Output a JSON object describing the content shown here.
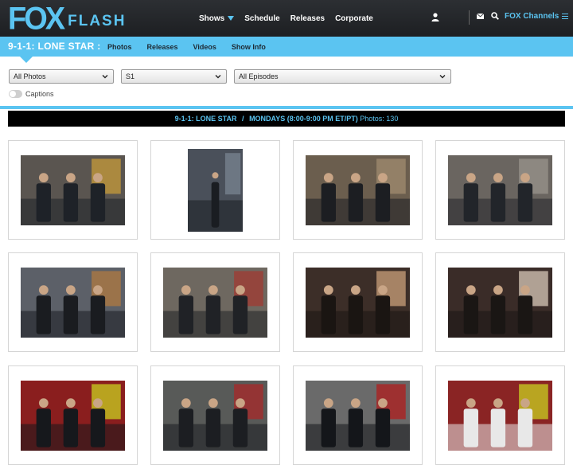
{
  "header": {
    "logo_main": "FOX",
    "logo_sub": "FLASH",
    "nav": [
      "Shows",
      "Schedule",
      "Releases",
      "Corporate"
    ],
    "channels_label": "FOX Channels",
    "icons": [
      "user-icon",
      "mail-icon",
      "search-icon",
      "menu-icon"
    ]
  },
  "subnav": {
    "show_title": "9-1-1: LONE STAR :",
    "tabs": [
      "Photos",
      "Releases",
      "Videos",
      "Show Info"
    ]
  },
  "filters": {
    "photos_select": "All Photos",
    "season_select": "S1",
    "episode_select": "All Episodes",
    "captions_label": "Captions"
  },
  "info_bar": {
    "show": "9-1-1: LONE STAR",
    "separator": "/",
    "schedule": "MONDAYS (8:00-9:00 PM ET/PT)",
    "photos_count": "Photos: 130"
  },
  "colors": {
    "accent": "#5bc4f1",
    "header_bg": "#2c2f33"
  },
  "photos": [
    {
      "name": "photo-1",
      "orientation": "landscape",
      "palette": [
        "#5a5550",
        "#1e2228",
        "#c79b3a"
      ]
    },
    {
      "name": "photo-2",
      "orientation": "portrait",
      "palette": [
        "#4a505a",
        "#1a1d22",
        "#7a8492"
      ]
    },
    {
      "name": "photo-3",
      "orientation": "landscape",
      "palette": [
        "#6b5e4e",
        "#1c1e22",
        "#a08c70"
      ]
    },
    {
      "name": "photo-4",
      "orientation": "landscape",
      "palette": [
        "#6a6560",
        "#22252a",
        "#9a948c"
      ]
    },
    {
      "name": "photo-5",
      "orientation": "landscape",
      "palette": [
        "#5c6068",
        "#1a1c20",
        "#b07a40"
      ]
    },
    {
      "name": "photo-6",
      "orientation": "landscape",
      "palette": [
        "#6e6860",
        "#202226",
        "#a13a32"
      ]
    },
    {
      "name": "photo-7",
      "orientation": "landscape",
      "palette": [
        "#3c2e28",
        "#1a1512",
        "#c9a07a"
      ]
    },
    {
      "name": "photo-8",
      "orientation": "landscape",
      "palette": [
        "#3a2c28",
        "#1a1614",
        "#d8c8b8"
      ]
    },
    {
      "name": "photo-9",
      "orientation": "landscape",
      "palette": [
        "#8a1e1e",
        "#16181c",
        "#c8d020"
      ]
    },
    {
      "name": "photo-10",
      "orientation": "landscape",
      "palette": [
        "#585a58",
        "#1c1e22",
        "#a82828"
      ]
    },
    {
      "name": "photo-11",
      "orientation": "landscape",
      "palette": [
        "#6a6a6a",
        "#14161a",
        "#b01e1e"
      ]
    },
    {
      "name": "photo-12",
      "orientation": "portrait-wide",
      "palette": [
        "#8a2424",
        "#e8e8e8",
        "#c8d020"
      ]
    }
  ]
}
